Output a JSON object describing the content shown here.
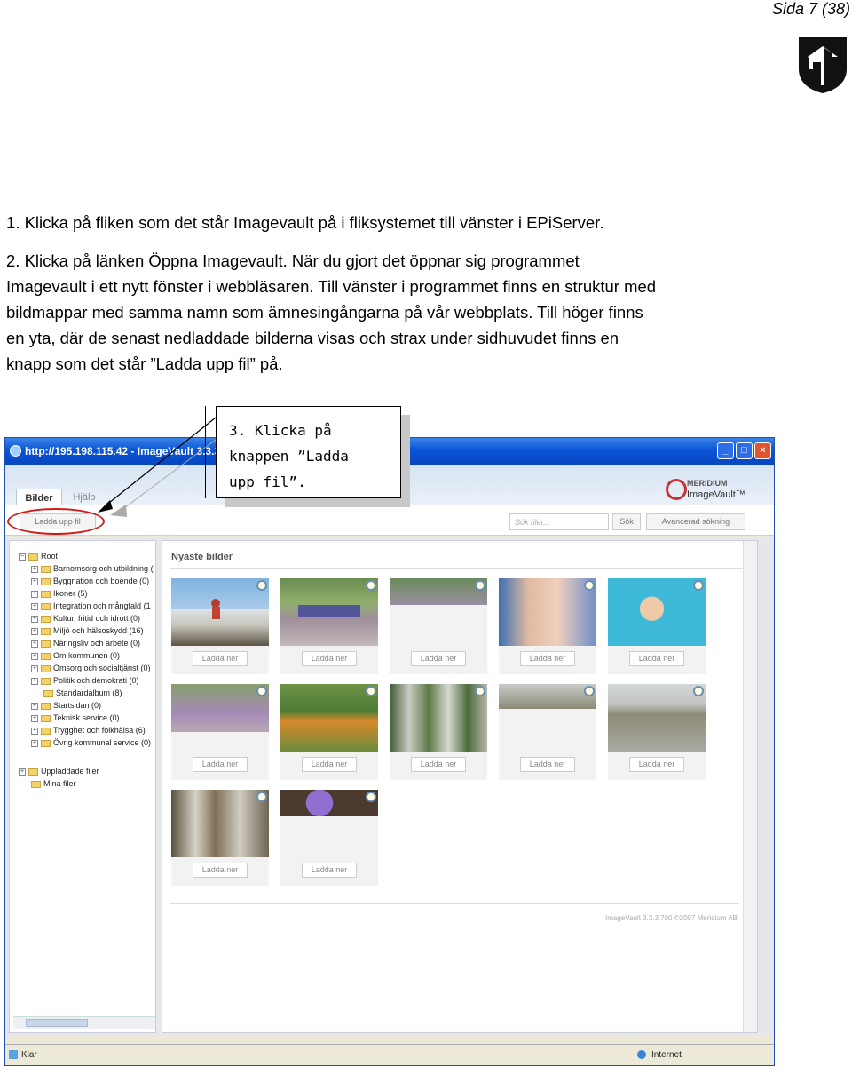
{
  "page": {
    "number": "Sida 7 (38)"
  },
  "instructions": {
    "step1": "1. Klicka på fliken som det står Imagevault på i fliksystemet till vänster i EPiServer.",
    "step2_lines": [
      "2. Klicka på länken Öppna Imagevault. När du gjort det öppnar sig programmet",
      "Imagevault i ett nytt fönster i webbläsaren. Till vänster i programmet finns en struktur med",
      "bildmappar med samma namn som ämnesingångarna på vår webbplats. Till höger finns",
      "en yta, där de senast nedladdade bilderna visas och strax under sidhuvudet finns en",
      "knapp som det står ”Ladda upp fil” på."
    ]
  },
  "callout": {
    "text": "3. Klicka på\nknappen ”Ladda\nupp fil”."
  },
  "browser": {
    "title": "http://195.198.115.42 - ImageVault 3.3.3",
    "tabs": {
      "active": "Bilder",
      "inactive": "Hjälp"
    },
    "logo": {
      "line1": "MERIDIUM",
      "line2": "ImageVault™"
    },
    "toolbar": {
      "upload_label": "Ladda upp fil",
      "search_placeholder": "Sök filer...",
      "search_button": "Sök",
      "advanced_search": "Avancerad sökning"
    },
    "tree": {
      "root": "Root",
      "folders": [
        "Barnomsorg och utbildning (",
        "Byggnation och boende (0)",
        "Ikoner (5)",
        "Integration och mångfald (1",
        "Kultur, fritid och idrott (0)",
        "Miljö och hälsoskydd (16)",
        "Näringsliv och arbete (0)",
        "Om kommunen (0)",
        "Omsorg och socialtjänst (0)",
        "Politik och demokrati (0)",
        "Standardalbum (8)",
        "Startsidan (0)",
        "Teknisk service (0)",
        "Trygghet och folkhälsa (6)",
        "Övrig kommunal service (0)"
      ],
      "uploaded": "Uppladdade filer",
      "my_files": "Mina filer"
    },
    "main": {
      "heading": "Nyaste bilder",
      "download_label": "Ladda ner",
      "copyright": "ImageVault 3.3.3.700 ©2007 Meridium AB"
    },
    "status": {
      "left": "Klar",
      "right": "Internet"
    }
  },
  "colors": {
    "accent_red": "#d21c1c",
    "xp_blue": "#0a55d6"
  }
}
